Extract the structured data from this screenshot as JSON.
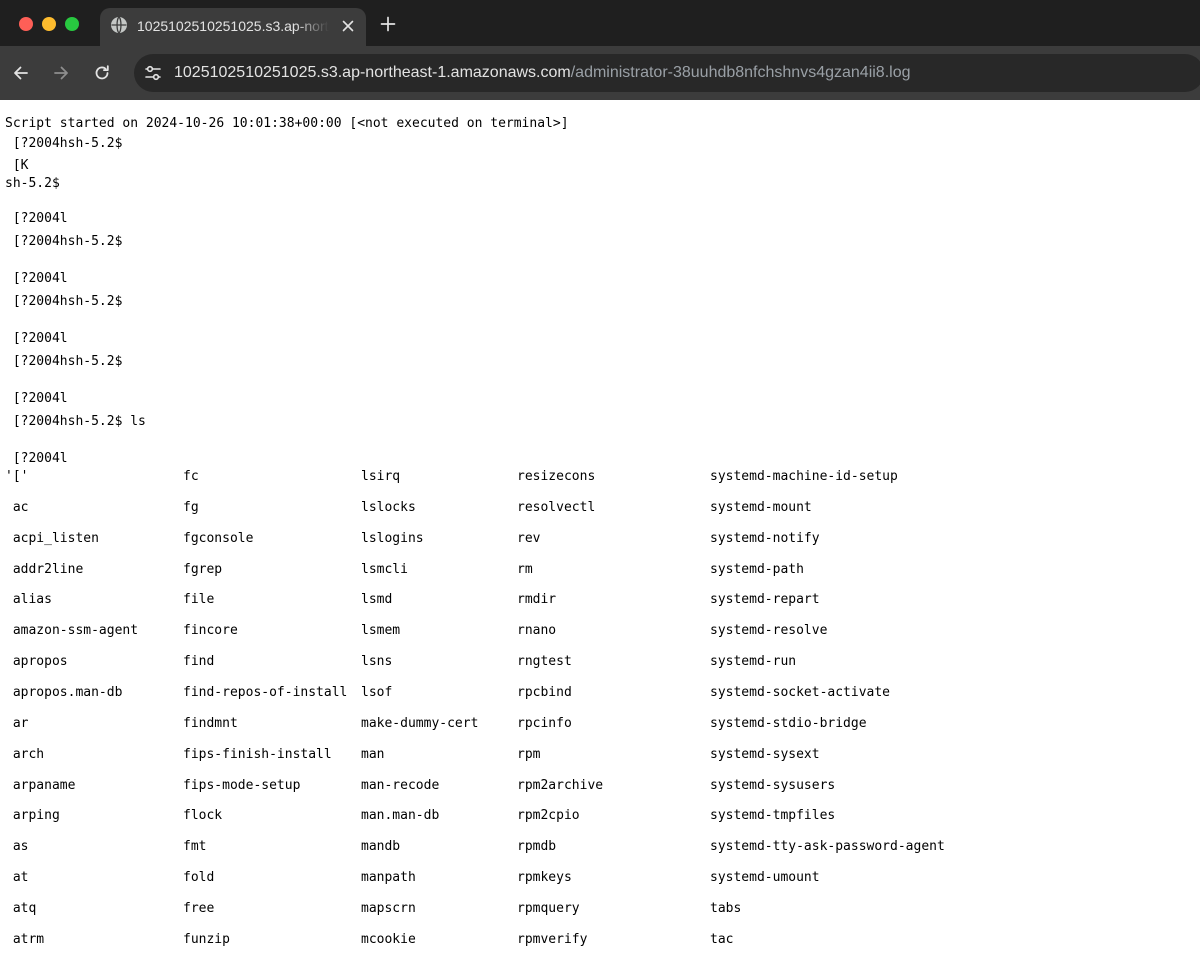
{
  "window": {
    "controls": [
      "close",
      "minimize",
      "maximize"
    ]
  },
  "tab": {
    "title": "1025102510251025.s3.ap-northeast-1.amazonaws.com/administrator-38uuhdb8nfchshnvs4gzan4ii8.log",
    "icon": "globe-icon",
    "close_icon": "close-icon"
  },
  "toolbar": {
    "back_icon": "back-arrow-icon",
    "forward_icon": "forward-arrow-icon",
    "reload_icon": "reload-icon",
    "site_info_icon": "tune-icon",
    "url_host": "1025102510251025.s3.ap-northeast-1.amazonaws.com",
    "url_path": "/administrator-38uuhdb8nfchshnvs4gzan4ii8.log"
  },
  "colors": {
    "tabbar_bg": "#1f1f1f",
    "toolbar_bg": "#3c3c3c",
    "omnibox_bg": "#282828",
    "text_light": "#e3e3e3",
    "text_dim": "#9aa0a6"
  },
  "log": {
    "lines": [
      "Script started on 2024-10-26 10:01:38+00:00 [<not executed on terminal>]",
      " [?2004hsh-5.2$ ",
      " [K",
      "sh-5.2$ ",
      " [?2004l",
      " [?2004hsh-5.2$ ",
      " [?2004l",
      " [?2004hsh-5.2$ ",
      " [?2004l",
      " [?2004hsh-5.2$ ",
      " [?2004l",
      " [?2004hsh-5.2$ ls",
      " [?2004l"
    ],
    "ls_columns": [
      [
        "'['",
        " ac",
        " acpi_listen",
        " addr2line",
        " alias",
        " amazon-ssm-agent",
        " apropos",
        " apropos.man-db",
        " ar",
        " arch",
        " arpaname",
        " arping",
        " as",
        " at",
        " atq",
        " atrm"
      ],
      [
        "fc",
        "fg",
        "fgconsole",
        "fgrep",
        "file",
        "fincore",
        "find",
        "find-repos-of-install",
        "findmnt",
        "fips-finish-install",
        "fips-mode-setup",
        "flock",
        "fmt",
        "fold",
        "free",
        "funzip"
      ],
      [
        "lsirq",
        "lslocks",
        "lslogins",
        "lsmcli",
        "lsmd",
        "lsmem",
        "lsns",
        "lsof",
        "make-dummy-cert",
        "man",
        "man-recode",
        "man.man-db",
        "mandb",
        "manpath",
        "mapscrn",
        "mcookie"
      ],
      [
        "resizecons",
        "resolvectl",
        "rev",
        "rm",
        "rmdir",
        "rnano",
        "rngtest",
        "rpcbind",
        "rpcinfo",
        "rpm",
        "rpm2archive",
        "rpm2cpio",
        "rpmdb",
        "rpmkeys",
        "rpmquery",
        "rpmverify"
      ],
      [
        "systemd-machine-id-setup",
        "systemd-mount",
        "systemd-notify",
        "systemd-path",
        "systemd-repart",
        "systemd-resolve",
        "systemd-run",
        "systemd-socket-activate",
        "systemd-stdio-bridge",
        "systemd-sysext",
        "systemd-sysusers",
        "systemd-tmpfiles",
        "systemd-tty-ask-password-agent",
        "systemd-umount",
        "tabs",
        "tac"
      ]
    ]
  }
}
